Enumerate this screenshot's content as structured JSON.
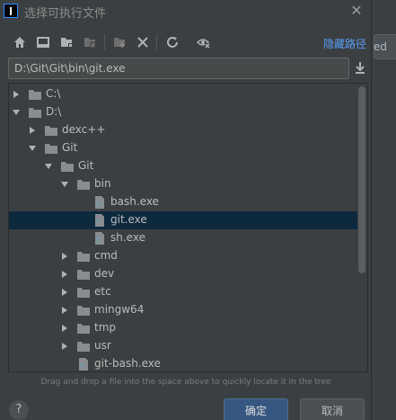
{
  "window": {
    "title": "选择可执行文件",
    "close_glyph": "✕"
  },
  "background_app": {
    "visible_text": "ed"
  },
  "toolbar": {
    "icons": [
      "home-icon",
      "desktop-icon",
      "new-folder-icon",
      "project-folder-icon",
      "new-folder-plus-icon",
      "delete-icon",
      "refresh-icon",
      "show-hidden-icon"
    ],
    "hide_path_label": "隐藏路径"
  },
  "path_field": {
    "value": "D:\\Git\\Git\\bin\\git.exe"
  },
  "tree": {
    "rows": [
      {
        "label": "C:\\",
        "expanded": false
      },
      {
        "label": "D:\\",
        "expanded": true
      },
      {
        "label": "dexc++",
        "expanded": false
      },
      {
        "label": "Git",
        "expanded": true
      },
      {
        "label": "Git",
        "expanded": true
      },
      {
        "label": "bin",
        "expanded": true
      },
      {
        "label": "bash.exe",
        "type": "exe"
      },
      {
        "label": "git.exe",
        "type": "exe",
        "selected": true
      },
      {
        "label": "sh.exe",
        "type": "exe"
      },
      {
        "label": "cmd",
        "expanded": false
      },
      {
        "label": "dev",
        "expanded": false
      },
      {
        "label": "etc",
        "expanded": false
      },
      {
        "label": "mingw64",
        "expanded": false
      },
      {
        "label": "tmp",
        "expanded": false
      },
      {
        "label": "usr",
        "expanded": false
      },
      {
        "label": "git-bash.exe",
        "type": "exe"
      }
    ]
  },
  "hint": "Drag and drop a file into the space above to quickly locate it in the tree",
  "footer": {
    "help_label": "?",
    "ok_label": "确定",
    "cancel_label": "取消"
  },
  "colors": {
    "selection": "#0d293e",
    "link": "#589df6",
    "ok_button": "#365880"
  }
}
